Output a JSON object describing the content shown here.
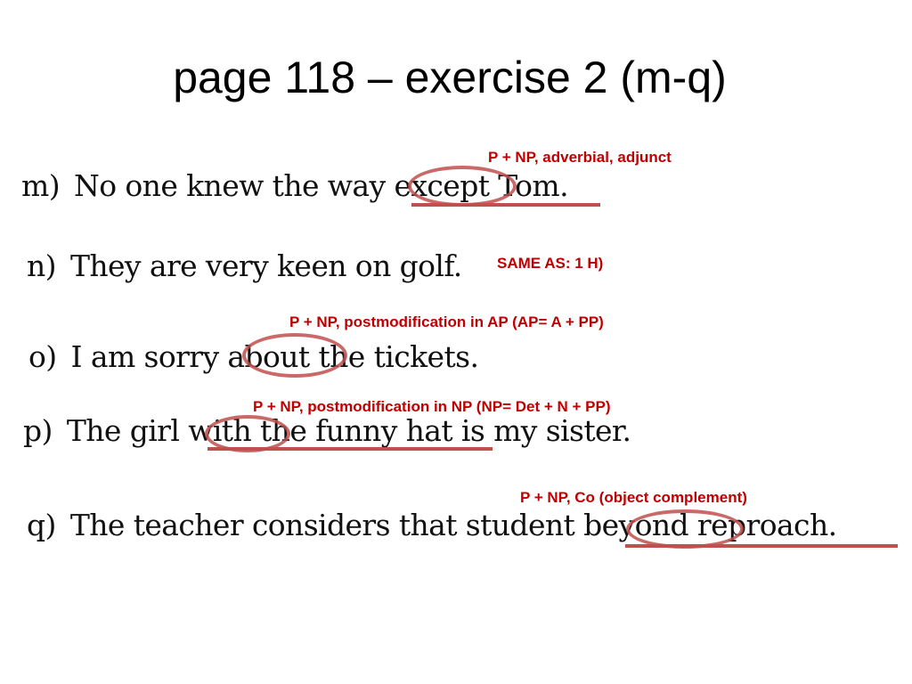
{
  "title": "page 118 – exercise 2 (m-q)",
  "accent_color": "#c0504d",
  "annotation_color": "#c00000",
  "items": [
    {
      "label": "m)",
      "text": "No one knew the way except Tom.",
      "annotation": "P + NP, adverbial, adjunct"
    },
    {
      "label": "n)",
      "text": "They are very keen on golf.",
      "annotation": "SAME AS: 1 H)"
    },
    {
      "label": "o)",
      "text": "I am sorry about the tickets.",
      "annotation": "P + NP, postmodification in AP (AP= A + PP)"
    },
    {
      "label": "p)",
      "text": "The girl with the funny hat is my sister.",
      "annotation": "P + NP, postmodification in NP (NP= Det + N + PP)"
    },
    {
      "label": "q)",
      "text": "The teacher considers that student beyond reproach.",
      "annotation": "P + NP, Co (object complement)"
    }
  ]
}
